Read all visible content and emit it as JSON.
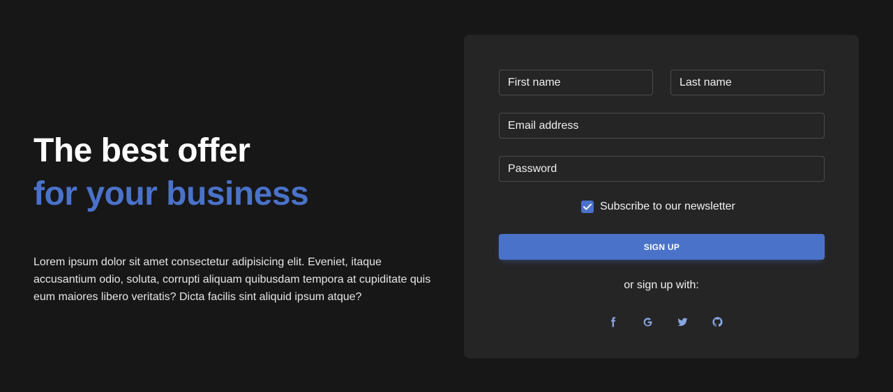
{
  "hero": {
    "title_line1": "The best offer",
    "title_line2": "for your business",
    "description": "Lorem ipsum dolor sit amet consectetur adipisicing elit. Eveniet, itaque accusantium odio, soluta, corrupti aliquam quibusdam tempora at cupiditate quis eum maiores libero veritatis? Dicta facilis sint aliquid ipsum atque?"
  },
  "form": {
    "first_name_placeholder": "First name",
    "last_name_placeholder": "Last name",
    "email_placeholder": "Email address",
    "password_placeholder": "Password",
    "subscribe_label": "Subscribe to our newsletter",
    "subscribe_checked": true,
    "signup_label": "SIGN UP",
    "or_text": "or sign up with:"
  },
  "socials": [
    {
      "icon": "facebook-icon"
    },
    {
      "icon": "google-icon"
    },
    {
      "icon": "twitter-icon"
    },
    {
      "icon": "github-icon"
    }
  ],
  "colors": {
    "background": "#171718",
    "card": "#252526",
    "accent": "#4a72c9",
    "social_icon": "#8aa6e0"
  }
}
